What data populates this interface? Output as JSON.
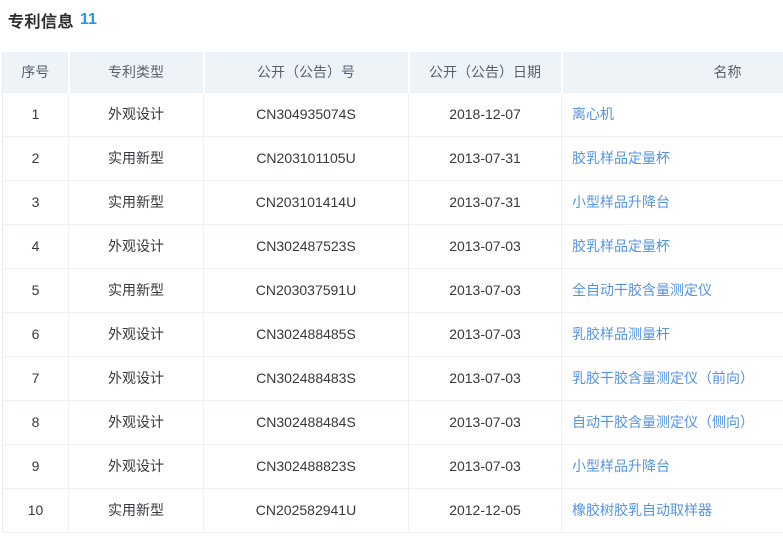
{
  "page": {
    "title": "专利信息",
    "count": "11"
  },
  "colors": {
    "title_count_blue": "#2096f0",
    "link_blue": "#5594e4",
    "header_bg": "#eef3f8",
    "header_text": "#54626f",
    "body_text": "#35393e",
    "border": "#eef1f4"
  },
  "table": {
    "columns": [
      "序号",
      "专利类型",
      "公开（公告）号",
      "公开（公告）日期",
      "名称"
    ],
    "rows": [
      {
        "index": "1",
        "type": "外观设计",
        "number": "CN304935074S",
        "date": "2018-12-07",
        "name": "离心机"
      },
      {
        "index": "2",
        "type": "实用新型",
        "number": "CN203101105U",
        "date": "2013-07-31",
        "name": "胶乳样品定量杯"
      },
      {
        "index": "3",
        "type": "实用新型",
        "number": "CN203101414U",
        "date": "2013-07-31",
        "name": "小型样品升降台"
      },
      {
        "index": "4",
        "type": "外观设计",
        "number": "CN302487523S",
        "date": "2013-07-03",
        "name": "胶乳样品定量杯"
      },
      {
        "index": "5",
        "type": "实用新型",
        "number": "CN203037591U",
        "date": "2013-07-03",
        "name": "全自动干胶含量测定仪"
      },
      {
        "index": "6",
        "type": "外观设计",
        "number": "CN302488485S",
        "date": "2013-07-03",
        "name": "乳胶样品测量杆"
      },
      {
        "index": "7",
        "type": "外观设计",
        "number": "CN302488483S",
        "date": "2013-07-03",
        "name": "乳胶干胶含量测定仪（前向）"
      },
      {
        "index": "8",
        "type": "外观设计",
        "number": "CN302488484S",
        "date": "2013-07-03",
        "name": "自动干胶含量测定仪（侧向）"
      },
      {
        "index": "9",
        "type": "外观设计",
        "number": "CN302488823S",
        "date": "2013-07-03",
        "name": "小型样品升降台"
      },
      {
        "index": "10",
        "type": "实用新型",
        "number": "CN202582941U",
        "date": "2012-12-05",
        "name": "橡胶树胶乳自动取样器"
      }
    ]
  }
}
